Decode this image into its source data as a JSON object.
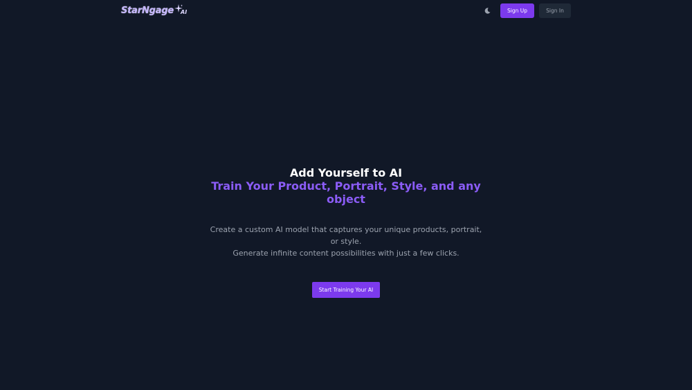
{
  "brand": {
    "name": "StarNgage",
    "suffix": "AI",
    "accent_color": "#7c3aed",
    "background_color": "#111827"
  },
  "nav": {
    "theme_toggle_icon": "moon-icon",
    "sign_up_label": "Sign Up",
    "sign_in_label": "Sign In"
  },
  "hero": {
    "title": "Add Yourself to AI",
    "subtitle": "Train Your Product, Portrait, Style, and any object",
    "description_line1": "Create a custom AI model that captures your unique products, portrait, or style.",
    "description_line2": "Generate infinite content possibilities with just a few clicks.",
    "cta_label": "Start Training Your AI"
  }
}
